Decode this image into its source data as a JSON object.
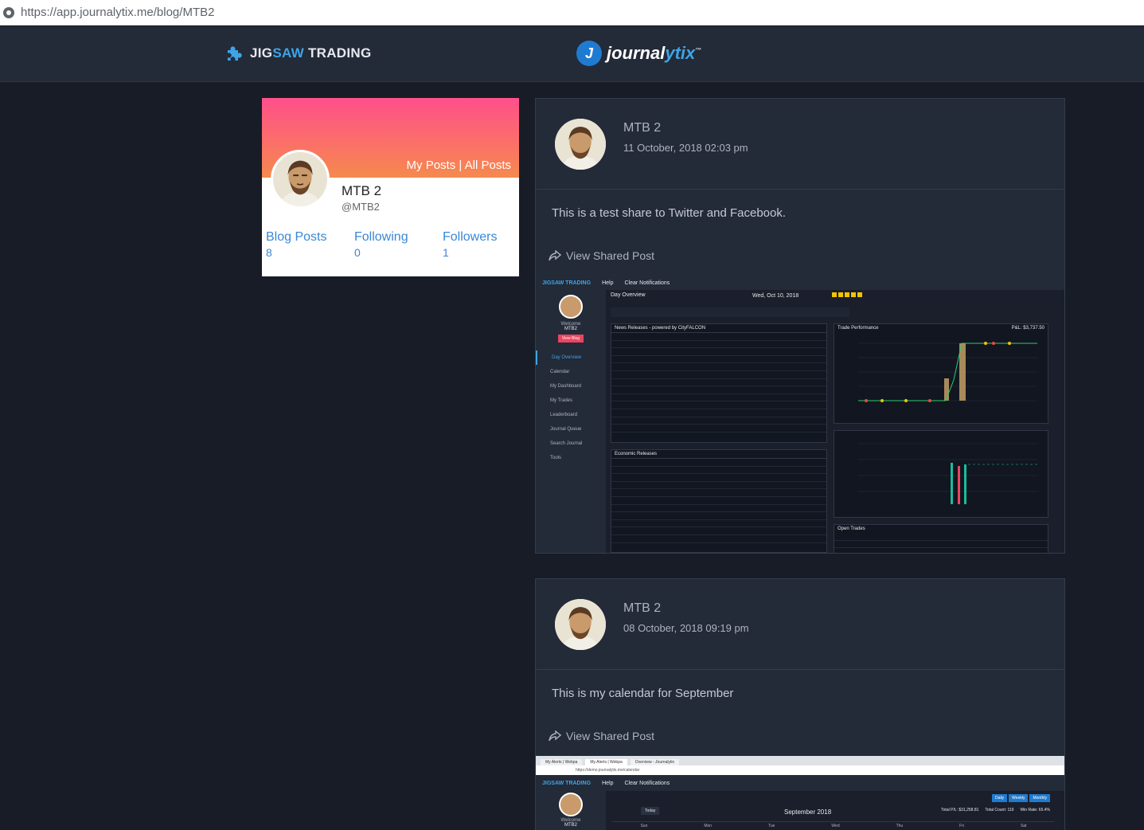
{
  "browser": {
    "url": "https://app.journalytix.me/blog/MTB2"
  },
  "header": {
    "brand_left_a": "JIG",
    "brand_left_b": "SAW",
    "brand_left_c": " TRADING",
    "brand_center_a": "journal",
    "brand_center_b": "ytix",
    "brand_center_tm": "™"
  },
  "profile": {
    "links": {
      "my_posts": "My Posts",
      "separator": " | ",
      "all_posts": "All Posts"
    },
    "name": "MTB 2",
    "handle": "@MTB2",
    "stats": [
      {
        "label": "Blog Posts",
        "value": "8"
      },
      {
        "label": "Following",
        "value": "0"
      },
      {
        "label": "Followers",
        "value": "1"
      }
    ]
  },
  "posts": [
    {
      "author": "MTB 2",
      "date": "11 October, 2018 02:03 pm",
      "body": "This is a test share to Twitter and Facebook.",
      "share_label": "View Shared Post"
    },
    {
      "author": "MTB 2",
      "date": "08 October, 2018 09:19 pm",
      "body": "This is my calendar for September",
      "share_label": "View Shared Post"
    }
  ],
  "shot1": {
    "brand": "JIGSAW TRADING",
    "help": "Help",
    "clear": "Clear Notifications",
    "welcome": "Welcome",
    "user": "MTB2",
    "view_blog": "View Blog",
    "page": "Day Overview",
    "date": "Wed, Oct 10, 2018",
    "nav": [
      "Day Overview",
      "Calendar",
      "My Dashboard",
      "My Trades",
      "Leaderboard",
      "Journal Queue",
      "Search Journal",
      "Tools"
    ],
    "news_title": "News Releases - powered by CityFALCON",
    "econ_title": "Economic Releases",
    "perf_title": "Trade Performance",
    "pnl": "P&L: $3,737.50",
    "open_trades": "Open Trades"
  },
  "shot2": {
    "brand": "JIGSAW TRADING",
    "help": "Help",
    "clear": "Clear Notifications",
    "month": "September 2018",
    "today": "Today",
    "views": [
      "Daily",
      "Weekly",
      "Monthly"
    ],
    "welcome": "Welcome",
    "user": "MTB2",
    "days": [
      "Sun",
      "Mon",
      "Tue",
      "Wed",
      "Thu",
      "Fri",
      "Sat"
    ],
    "total_pnl": "Total P/L: $31,258.81",
    "total_count": "Total Count: 119",
    "win_rate": "Win Rate: 65.4%",
    "tabs": [
      "My Alerts | Webpa",
      "My Alerts | Webpa",
      "Overview - Journalytix"
    ],
    "url": "https://demo.journalytix.me/calendar"
  },
  "colors": {
    "accent": "#3ea4e6",
    "banner_top": "#ff4f8b",
    "banner_bottom": "#f58a4d",
    "bg": "#181c26"
  }
}
